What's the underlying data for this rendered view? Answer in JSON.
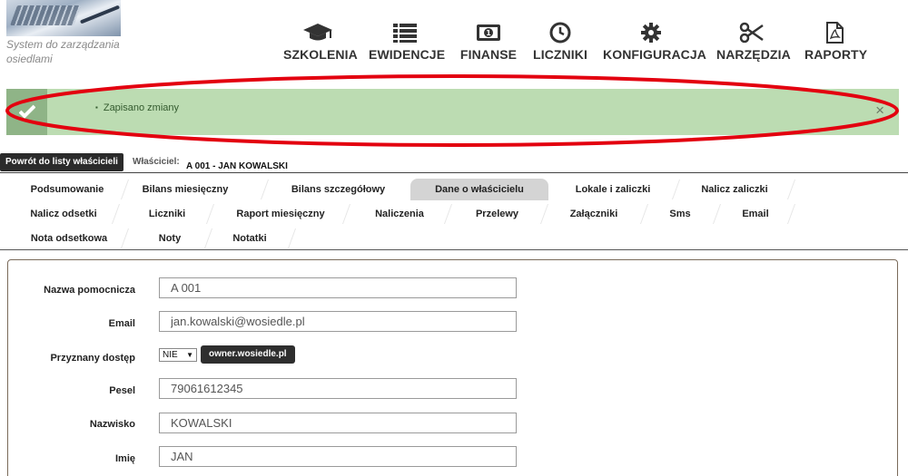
{
  "header": {
    "tagline": "System do zarządzania osiedlami",
    "nav": [
      {
        "label": "SZKOLENIA",
        "icon": "graduation-cap-icon"
      },
      {
        "label": "EWIDENCJE",
        "icon": "list-icon"
      },
      {
        "label": "FINANSE",
        "icon": "banknote-icon"
      },
      {
        "label": "LICZNIKI",
        "icon": "clock-icon"
      },
      {
        "label": "KONFIGURACJA",
        "icon": "gear-icon"
      },
      {
        "label": "NARZĘDZIA",
        "icon": "scissors-icon"
      },
      {
        "label": "RAPORTY",
        "icon": "pdf-file-icon"
      }
    ]
  },
  "alert": {
    "message": "Zapisano zmiany",
    "close": "×",
    "color_bg": "#bcdcb2",
    "color_side": "#8fb487"
  },
  "owner": {
    "back_label": "Powrót do listy właścicieli",
    "label": "Właściciel:",
    "value": "A 001 - JAN KOWALSKI"
  },
  "tabs": {
    "row1": [
      "Podsumowanie",
      "Bilans miesięczny",
      "Bilans szczegółowy",
      "Dane o właścicielu",
      "Lokale i zaliczki",
      "Nalicz zaliczki"
    ],
    "row2": [
      "Nalicz odsetki",
      "Liczniki",
      "Raport miesięczny",
      "Naliczenia",
      "Przelewy",
      "Załączniki",
      "Sms",
      "Email"
    ],
    "row3": [
      "Nota odsetkowa",
      "Noty",
      "Notatki"
    ],
    "active": "Dane o właścicielu"
  },
  "form": {
    "nazwa_label": "Nazwa pomocnicza",
    "nazwa_value": "A 001",
    "email_label": "Email",
    "email_value": "jan.kowalski@wosiedle.pl",
    "dostep_label": "Przyznany dostęp",
    "dostep_value": "NIE",
    "dostep_button": "owner.wosiedle.pl",
    "pesel_label": "Pesel",
    "pesel_value": "79061612345",
    "nazwisko_label": "Nazwisko",
    "nazwisko_value": "KOWALSKI",
    "imie_label": "Imię",
    "imie_value": "JAN"
  },
  "annotation_color": "#e3000f"
}
